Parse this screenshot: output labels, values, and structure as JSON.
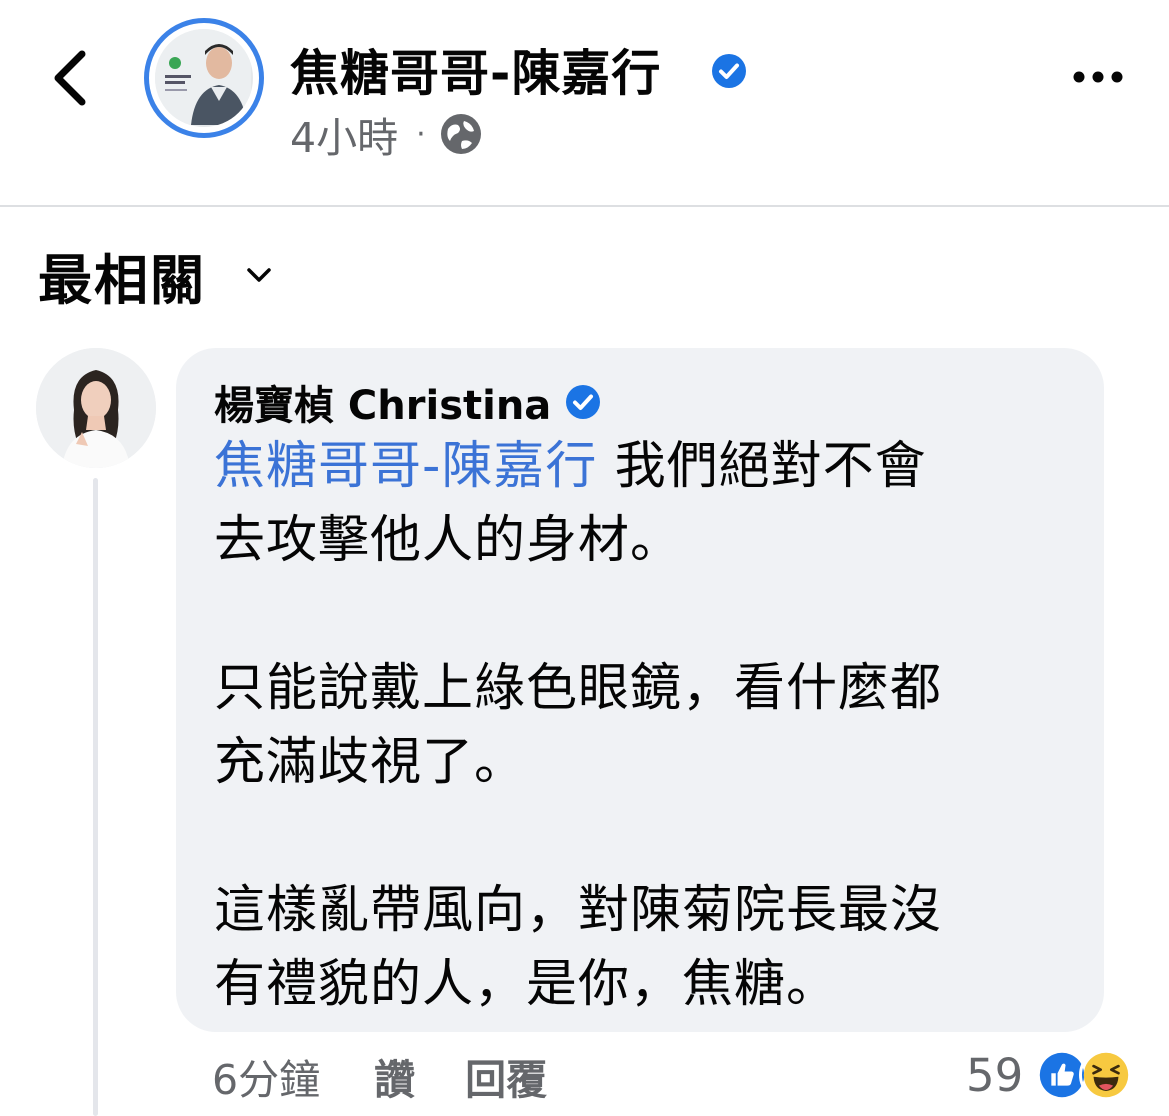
{
  "post": {
    "page_name": "焦糖哥哥-陳嘉行",
    "time": "4小時",
    "separator": "·",
    "verified": true,
    "audience_icon": "globe-icon"
  },
  "sort": {
    "label": "最相關",
    "icon": "chevron-down-icon"
  },
  "comment": {
    "author": "楊寶楨 Christina",
    "verified": true,
    "mention": "焦糖哥哥-陳嘉行",
    "line1_rest": " 我們絕對不會",
    "line2": "去攻擊他人的身材。",
    "para2_line1": "只能說戴上綠色眼鏡，看什麼都",
    "para2_line2": "充滿歧視了。",
    "para3_line1": "這樣亂帶風向，對陳菊院長最沒",
    "para3_line2": "有禮貌的人，是你，焦糖。",
    "time": "6分鐘",
    "like_label": "讚",
    "reply_label": "回覆",
    "reaction_count": "59",
    "reactions": [
      "like-icon",
      "haha-icon"
    ]
  },
  "colors": {
    "accent_blue": "#3b73d6",
    "verified_blue": "#1b74e4",
    "secondary_text": "#65676b",
    "bubble_bg": "#f0f2f5"
  }
}
